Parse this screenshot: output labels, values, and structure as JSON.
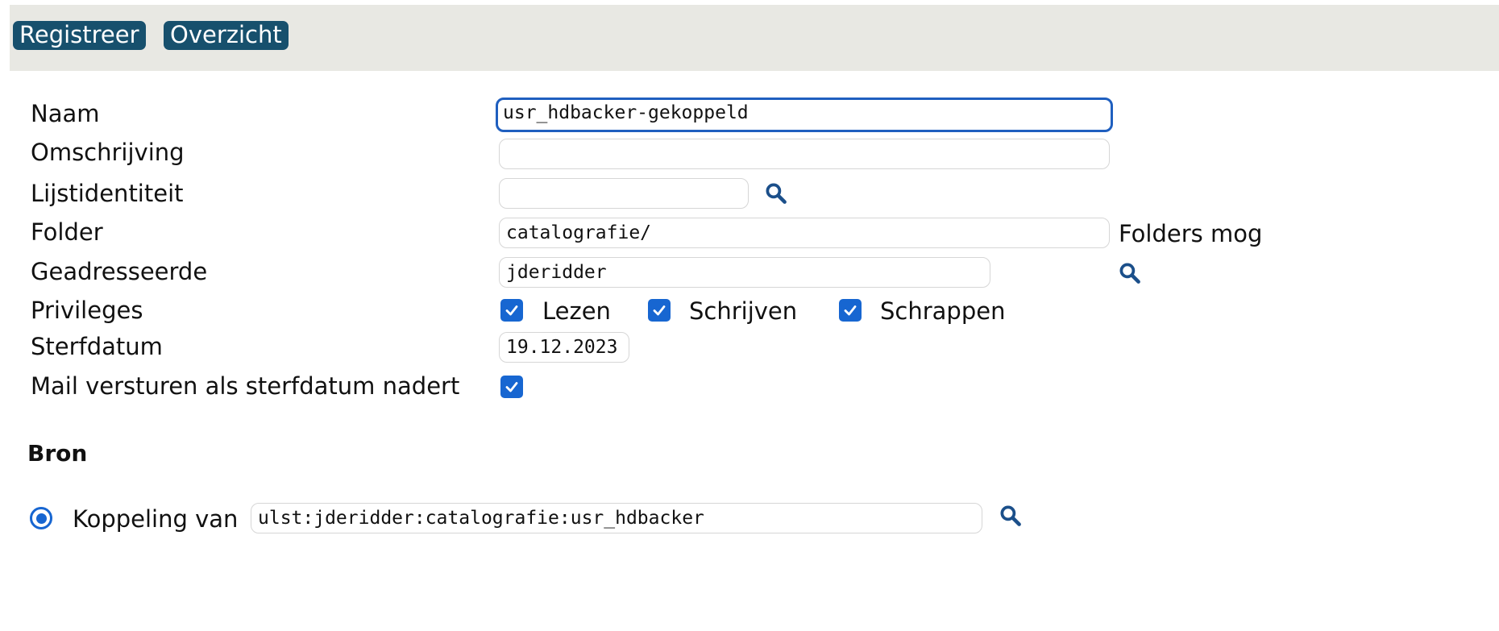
{
  "nav": {
    "register_label": "Registreer",
    "overview_label": "Overzicht"
  },
  "form": {
    "naam": {
      "label": "Naam",
      "value": "usr_hdbacker-gekoppeld"
    },
    "omschrijving": {
      "label": "Omschrijving",
      "value": ""
    },
    "lijstidentiteit": {
      "label": "Lijstidentiteit",
      "value": ""
    },
    "folder": {
      "label": "Folder",
      "value": "catalografie/",
      "hint": "Folders mog"
    },
    "geadresseerde": {
      "label": "Geadresseerde",
      "value": "jderidder"
    },
    "privileges": {
      "label": "Privileges",
      "options": [
        {
          "label": "Lezen",
          "checked": true
        },
        {
          "label": "Schrijven",
          "checked": true
        },
        {
          "label": "Schrappen",
          "checked": true
        }
      ]
    },
    "sterfdatum": {
      "label": "Sterfdatum",
      "value": "19.12.2023"
    },
    "mail": {
      "label": "Mail versturen als sterfdatum nadert",
      "checked": true
    }
  },
  "bron": {
    "heading": "Bron",
    "koppeling": {
      "label": "Koppeling van",
      "value": "ulst:jderidder:catalografie:usr_hdbacker",
      "selected": true
    }
  },
  "icons": {
    "search": "magnifier-icon",
    "checkbox": "check-icon",
    "radio": "radio-selected-icon"
  },
  "colors": {
    "nav_button_bg": "#17506d",
    "topbar_bg": "#e8e8e3",
    "accent": "#1766d1",
    "focus_border": "#1f5fbf",
    "search_icon": "#1b4f8a"
  }
}
